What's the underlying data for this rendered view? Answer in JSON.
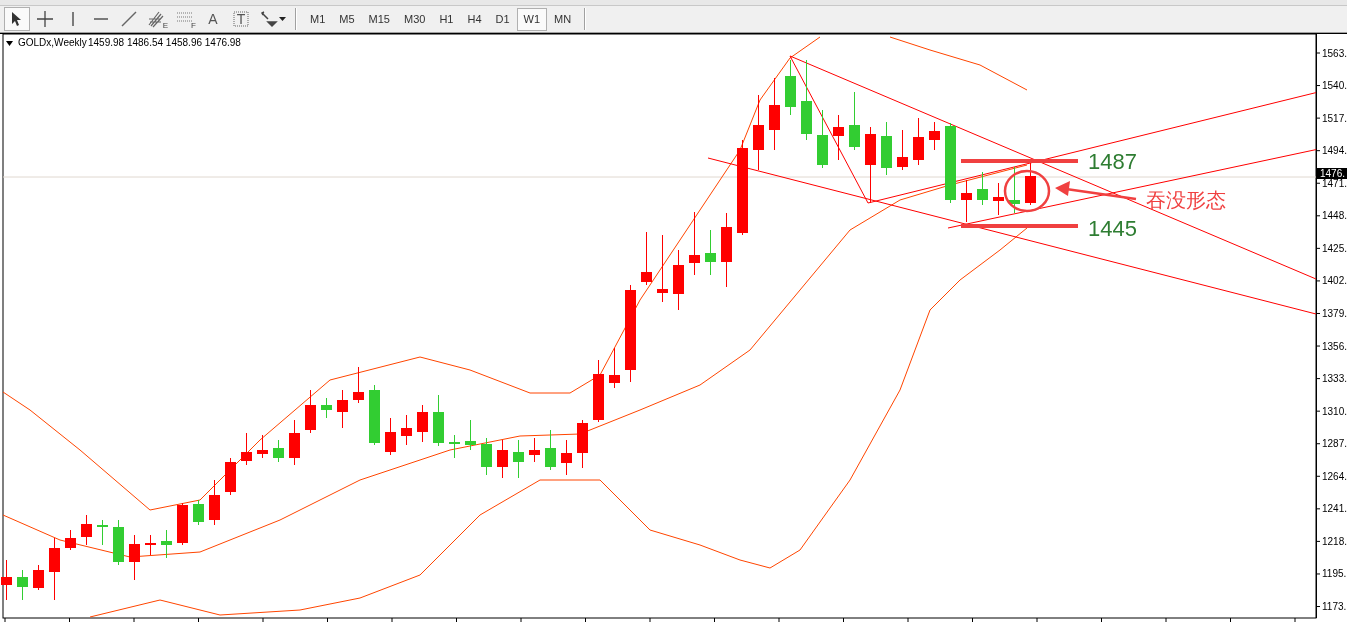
{
  "toolbar": {
    "tools": [
      {
        "kind": "cursor",
        "selected": true
      },
      {
        "kind": "crosshair",
        "selected": false
      },
      {
        "kind": "vline",
        "selected": false
      },
      {
        "kind": "hline",
        "selected": false
      },
      {
        "kind": "trendline",
        "selected": false
      },
      {
        "kind": "fibo",
        "mark": "E",
        "selected": false
      },
      {
        "kind": "grid",
        "mark": "F",
        "selected": false
      },
      {
        "kind": "glyph",
        "mark": "A",
        "selected": false
      },
      {
        "kind": "label",
        "mark": "T",
        "selected": false
      },
      {
        "kind": "arrows",
        "selected": false
      }
    ],
    "timeframes": [
      {
        "label": "M1",
        "selected": false
      },
      {
        "label": "M5",
        "selected": false
      },
      {
        "label": "M15",
        "selected": false
      },
      {
        "label": "M30",
        "selected": false
      },
      {
        "label": "H1",
        "selected": false
      },
      {
        "label": "H4",
        "selected": false
      },
      {
        "label": "D1",
        "selected": false
      },
      {
        "label": "W1",
        "selected": true
      },
      {
        "label": "MN",
        "selected": false
      }
    ]
  },
  "chart": {
    "symbol": "GOLDx,Weekly",
    "ohlc": "1459.98 1486.54 1458.96 1476.98",
    "price_axis": [
      "1563.",
      "1540.",
      "1517.",
      "1494.",
      "1471.",
      "1448.",
      "1425.",
      "1402.",
      "1379.",
      "1356.",
      "1333.",
      "1310.",
      "1287.",
      "1264.",
      "1241.",
      "1218.",
      "1195.",
      "1173."
    ],
    "current_price": "1476.",
    "annotations": {
      "levels": [
        "1487",
        "1445"
      ],
      "note": "吞没形态"
    }
  }
}
